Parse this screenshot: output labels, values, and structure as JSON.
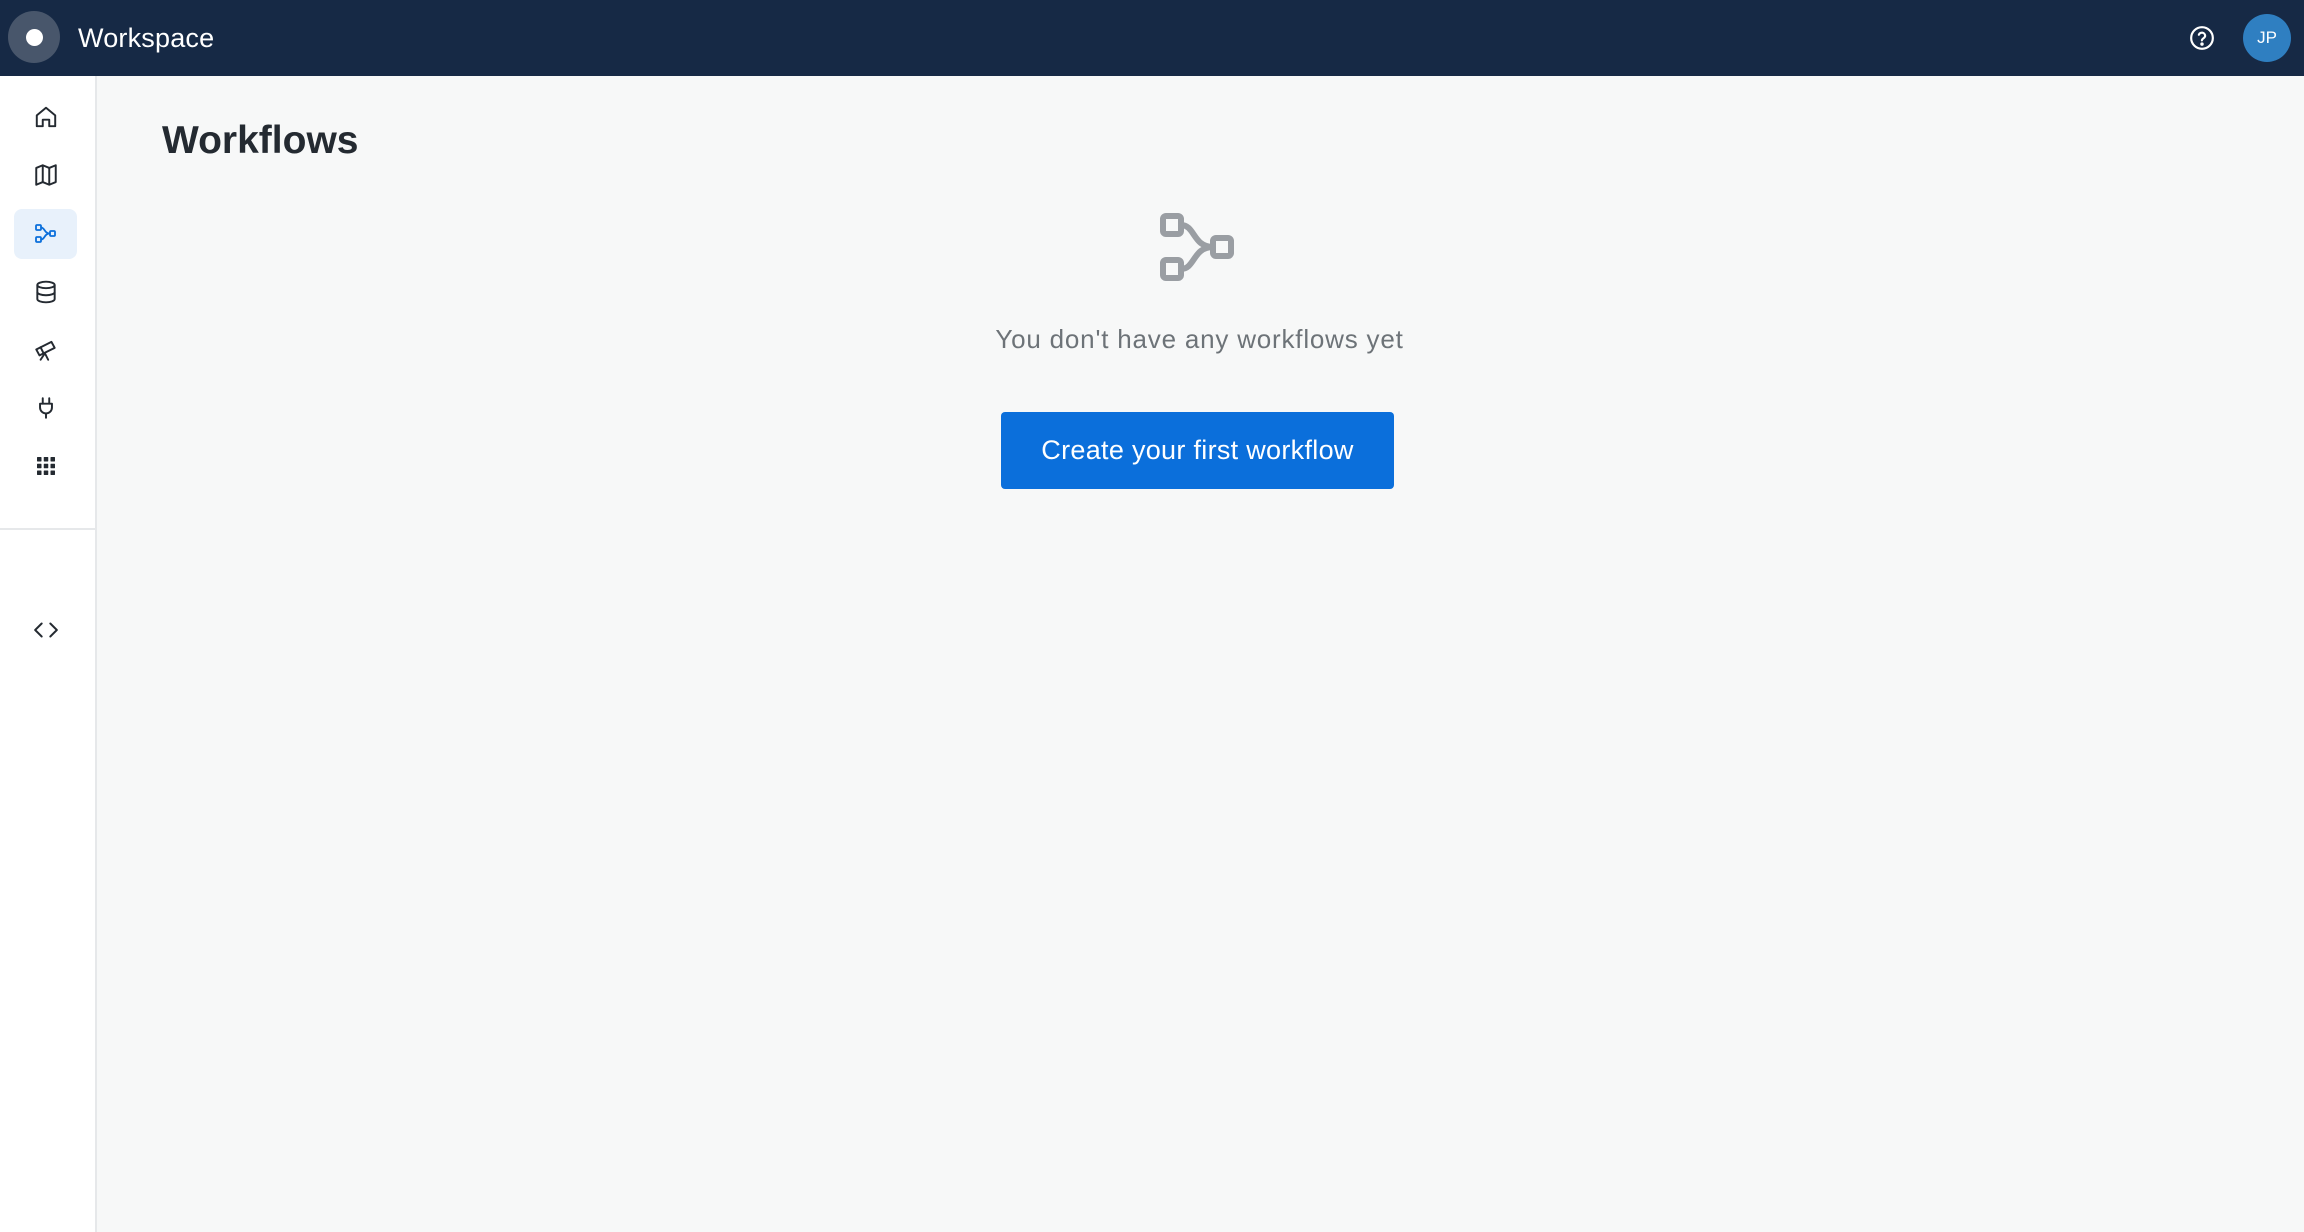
{
  "header": {
    "app_title": "Workspace",
    "logo_icon": "circle-logo-icon",
    "help_icon": "question-circle-icon",
    "avatar_initials": "JP",
    "background_color": "#162945",
    "avatar_color": "#2f7fc1"
  },
  "sidebar": {
    "items": [
      {
        "icon": "home-icon",
        "active": false
      },
      {
        "icon": "map-icon",
        "active": false
      },
      {
        "icon": "workflow-icon",
        "active": true
      },
      {
        "icon": "database-icon",
        "active": false
      },
      {
        "icon": "telescope-icon",
        "active": false
      },
      {
        "icon": "plug-icon",
        "active": false
      },
      {
        "icon": "apps-grid-icon",
        "active": false
      }
    ],
    "footer_items": [
      {
        "icon": "code-icon"
      }
    ],
    "active_color": "#0b6fdb"
  },
  "main": {
    "page_title": "Workflows",
    "empty_state": {
      "icon": "workflow-icon",
      "message": "You don't have any workflows yet",
      "cta_label": "Create your first workflow",
      "cta_color": "#0b6fdb"
    }
  }
}
